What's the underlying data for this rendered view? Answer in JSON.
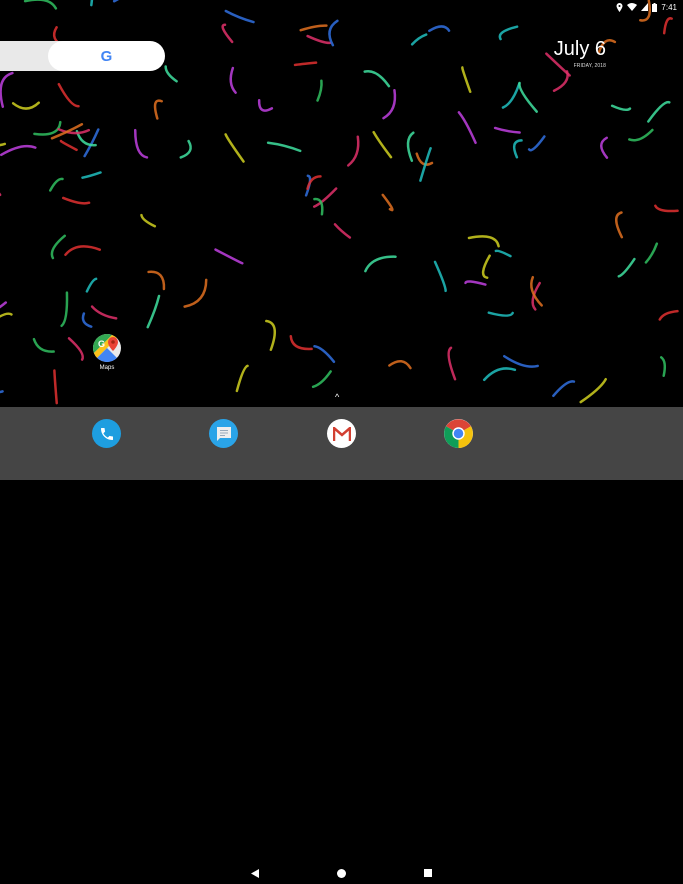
{
  "status_bar": {
    "time": "7:41",
    "icons": [
      "location-icon",
      "wifi-icon",
      "signal-icon",
      "battery-icon"
    ]
  },
  "search_widget": {
    "logo": "G"
  },
  "date_widget": {
    "date": "July 6",
    "day_year": "FRIDAY, 2018"
  },
  "desktop_apps": [
    {
      "label": "Maps",
      "icon": "maps-icon"
    }
  ],
  "app_drawer_handle": "^",
  "dock": {
    "apps": [
      {
        "name": "Phone",
        "icon": "phone-icon"
      },
      {
        "name": "Messages",
        "icon": "messages-icon"
      },
      {
        "name": "Gmail",
        "icon": "gmail-icon"
      },
      {
        "name": "Chrome",
        "icon": "chrome-icon"
      }
    ]
  },
  "nav_bar": {
    "buttons": [
      "back",
      "home",
      "recents"
    ]
  },
  "colors": {
    "dock": "#454545",
    "phone": "#1e9ee0",
    "messages": "#2aa4e8",
    "background": "#000000"
  }
}
